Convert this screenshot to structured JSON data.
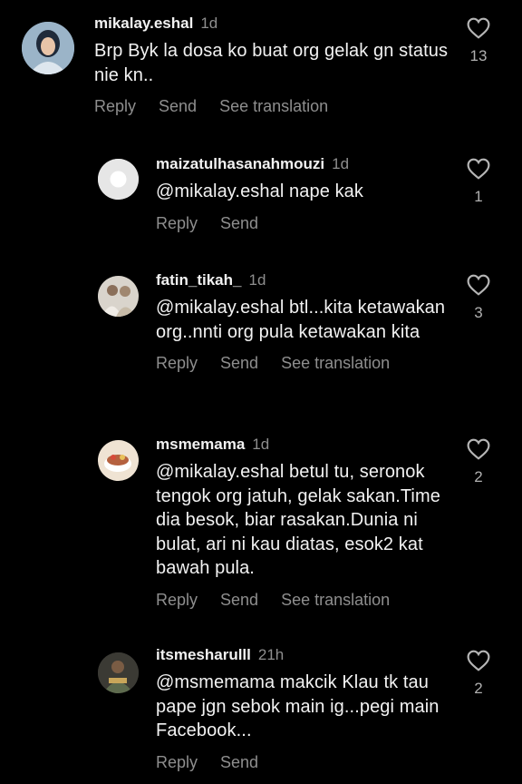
{
  "comments": [
    {
      "username": "mikalay.eshal",
      "time": "1d",
      "text": "Brp Byk la dosa ko buat org gelak gn status nie kn..",
      "actions": {
        "reply": "Reply",
        "send": "Send",
        "translate": "See translation"
      },
      "likes": "13"
    },
    {
      "username": "maizatulhasanahmouzi",
      "time": "1d",
      "text": "@mikalay.eshal nape kak",
      "actions": {
        "reply": "Reply",
        "send": "Send"
      },
      "likes": "1"
    },
    {
      "username": "fatin_tikah_",
      "time": "1d",
      "text": "@mikalay.eshal btl...kita ketawakan org..nnti org pula ketawakan kita",
      "actions": {
        "reply": "Reply",
        "send": "Send",
        "translate": "See translation"
      },
      "likes": "3"
    },
    {
      "username": "msmemama",
      "time": "1d",
      "text": "@mikalay.eshal betul tu, seronok tengok org jatuh, gelak sakan.Time dia besok, biar rasakan.Dunia ni bulat, ari ni kau diatas, esok2 kat bawah pula.",
      "actions": {
        "reply": "Reply",
        "send": "Send",
        "translate": "See translation"
      },
      "likes": "2"
    },
    {
      "username": "itsmesharulll",
      "time": "21h",
      "text": "@msmemama makcik Klau tk tau pape jgn sebok main ig...pegi main Facebook...",
      "actions": {
        "reply": "Reply",
        "send": "Send"
      },
      "likes": "2"
    }
  ],
  "icons": {
    "like": "heart-outline-icon",
    "avatar_placeholder": "default-avatar-icon"
  },
  "colors": {
    "background": "#000000",
    "primary_text": "#f2f2f2",
    "secondary_text": "#8e8e8e"
  }
}
